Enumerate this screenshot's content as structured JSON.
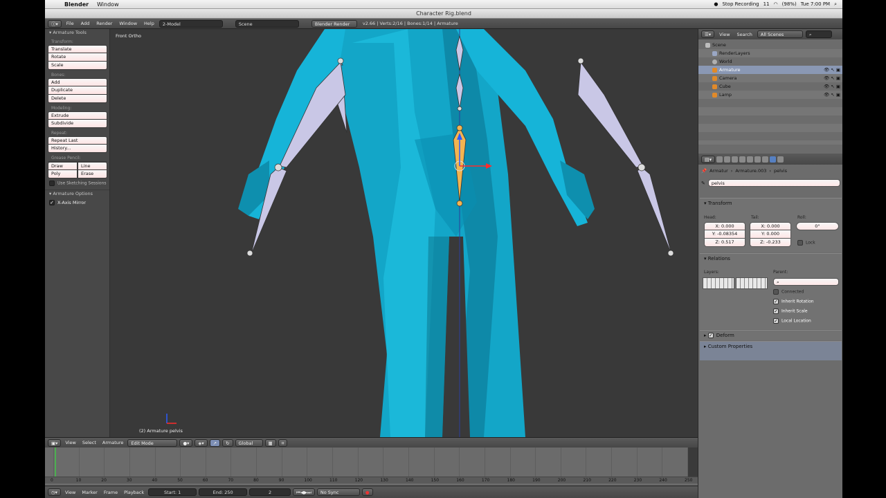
{
  "mac_menubar": {
    "app_name": "Blender",
    "menu_window": "Window",
    "stop_recording": "Stop Recording",
    "battery": "(98%)",
    "clock": "Tue 7:00 PM",
    "badge_count": "11"
  },
  "window_title": "Character Rig.blend",
  "info_header": {
    "menus": [
      "File",
      "Add",
      "Render",
      "Window",
      "Help"
    ],
    "screen_layout": "2-Model",
    "scene": "Scene",
    "render_engine": "Blender Render",
    "stats": "v2.66 | Verts:2/16 | Bones:1/14 | Armature"
  },
  "toolshelf": {
    "title": "Armature Tools",
    "transform_label": "Transform:",
    "translate": "Translate",
    "rotate": "Rotate",
    "scale": "Scale",
    "bones_label": "Bones:",
    "add": "Add",
    "duplicate": "Duplicate",
    "delete": "Delete",
    "modeling_label": "Modeling:",
    "extrude": "Extrude",
    "subdivide": "Subdivide",
    "repeat_label": "Repeat:",
    "repeat_last": "Repeat Last",
    "history": "History...",
    "grease_label": "Grease Pencil:",
    "draw": "Draw",
    "line": "Line",
    "poly": "Poly",
    "erase": "Erase",
    "use_sketching": "Use Sketching Sessions",
    "options_title": "Armature Options",
    "xaxis_mirror": "X-Axis Mirror"
  },
  "viewport": {
    "view_label": "Front Ortho",
    "active_label": "(2) Armature pelvis"
  },
  "viewport_header": {
    "view": "View",
    "select": "Select",
    "armature": "Armature",
    "mode": "Edit Mode",
    "orientation": "Global"
  },
  "timeline": {
    "ticks": [
      "0",
      "10",
      "20",
      "30",
      "40",
      "50",
      "60",
      "70",
      "80",
      "90",
      "100",
      "110",
      "120",
      "130",
      "140",
      "150",
      "160",
      "170",
      "180",
      "190",
      "200",
      "210",
      "220",
      "230",
      "240",
      "250"
    ],
    "view": "View",
    "marker": "Marker",
    "frame": "Frame",
    "playback": "Playback",
    "start": "Start: 1",
    "end": "End: 250",
    "current": "2",
    "sync": "No Sync"
  },
  "outliner": {
    "view": "View",
    "search": "Search",
    "filter": "All Scenes",
    "items": [
      {
        "label": "Scene",
        "color": "#bdbdbd"
      },
      {
        "label": "RenderLayers",
        "color": "#9aa7c4"
      },
      {
        "label": "World",
        "color": "#b0b0b0"
      },
      {
        "label": "Armature",
        "color": "#e08a2a"
      },
      {
        "label": "Camera",
        "color": "#e08a2a"
      },
      {
        "label": "Cube",
        "color": "#e08a2a"
      },
      {
        "label": "Lamp",
        "color": "#e08a2a"
      }
    ]
  },
  "properties": {
    "crumb1": "Armatur",
    "crumb2": "Armature.003",
    "crumb3": "pelvis",
    "bone_name": "pelvis",
    "transform_title": "Transform",
    "head_label": "Head:",
    "tail_label": "Tail:",
    "roll_label": "Roll:",
    "head_x": "X: 0.000",
    "head_y": "Y: -0.08354",
    "head_z": "Z: 0.517",
    "tail_x": "X: 0.000",
    "tail_y": "Y: 0.000",
    "tail_z": "Z: -0.233",
    "roll": "0°",
    "lock": "Lock",
    "relations_title": "Relations",
    "layers_label": "Layers:",
    "parent_label": "Parent:",
    "connected": "Connected",
    "inherit_rotation": "Inherit Rotation",
    "inherit_scale": "Inherit Scale",
    "local_location": "Local Location",
    "deform_title": "Deform",
    "custom_props_title": "Custom Properties"
  }
}
